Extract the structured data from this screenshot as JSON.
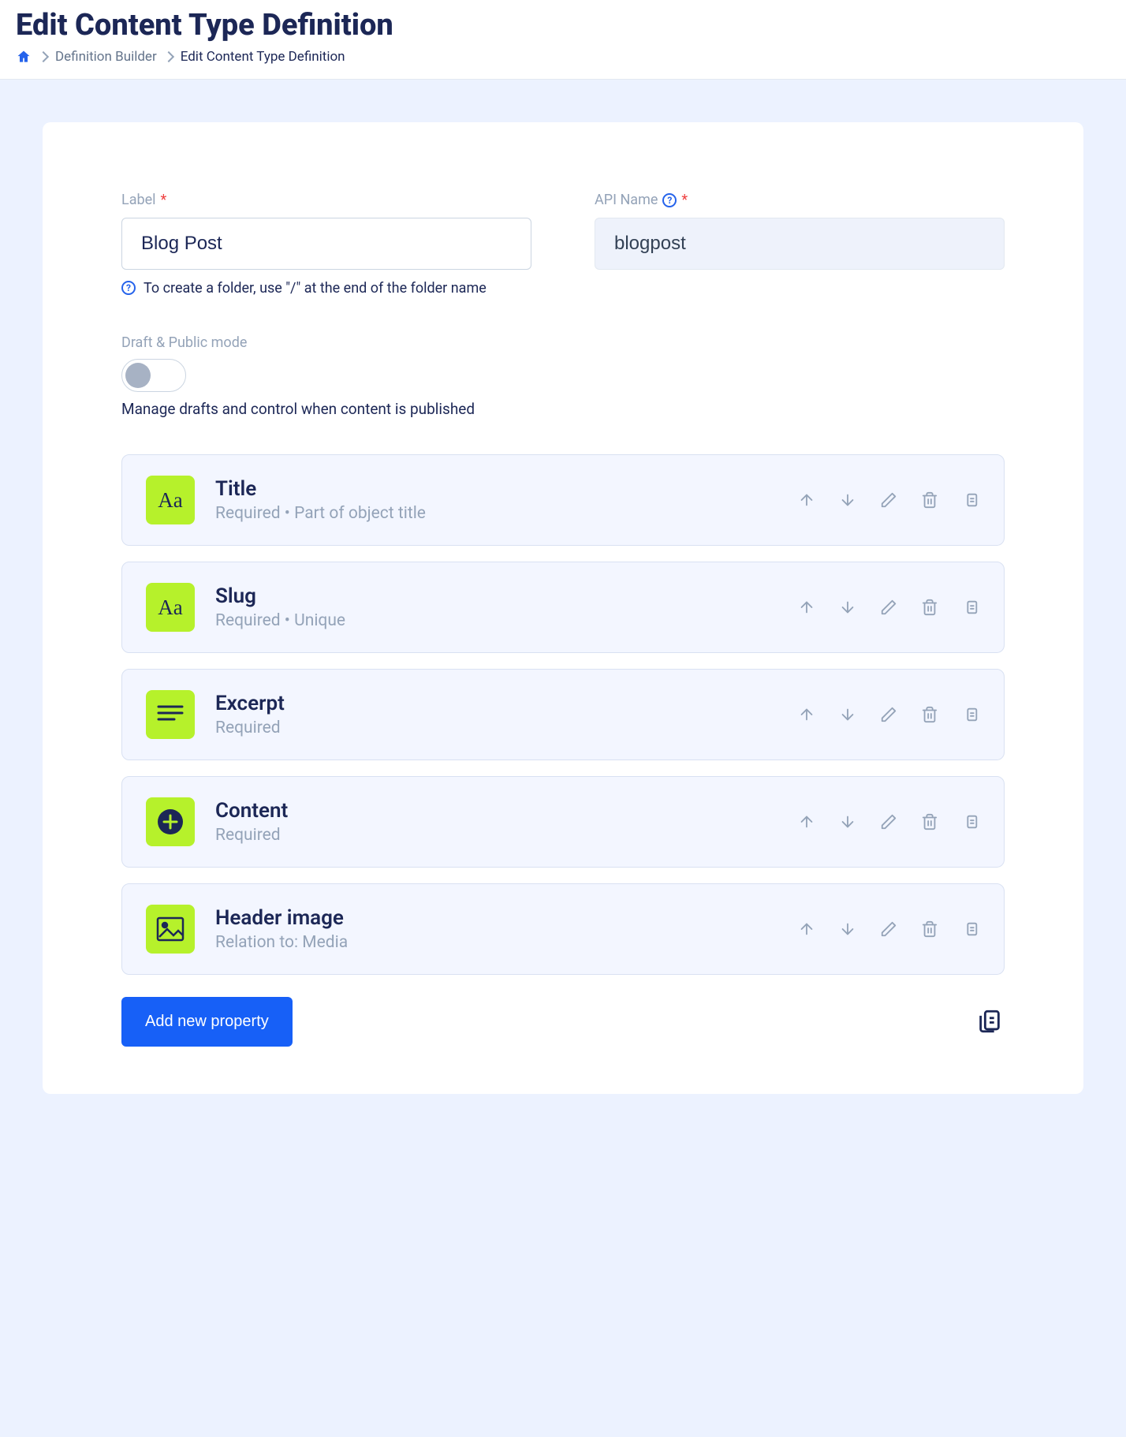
{
  "pageTitle": "Edit Content Type Definition",
  "breadcrumb": {
    "parent": "Definition Builder",
    "current": "Edit Content Type Definition"
  },
  "form": {
    "label": {
      "label": "Label",
      "value": "Blog Post",
      "helper": "To create a folder, use \"/\" at the end of the folder name"
    },
    "apiName": {
      "label": "API Name",
      "value": "blogpost"
    },
    "draftMode": {
      "label": "Draft & Public mode",
      "description": "Manage drafts and control when content is published"
    }
  },
  "fields": [
    {
      "iconType": "text",
      "title": "Title",
      "meta": "Required • Part of object title"
    },
    {
      "iconType": "text",
      "title": "Slug",
      "meta": "Required • Unique"
    },
    {
      "iconType": "textarea",
      "title": "Excerpt",
      "meta": "Required"
    },
    {
      "iconType": "plus",
      "title": "Content",
      "meta": "Required"
    },
    {
      "iconType": "image",
      "title": "Header image",
      "meta": "Relation to: Media"
    }
  ],
  "buttons": {
    "addProperty": "Add new property"
  }
}
